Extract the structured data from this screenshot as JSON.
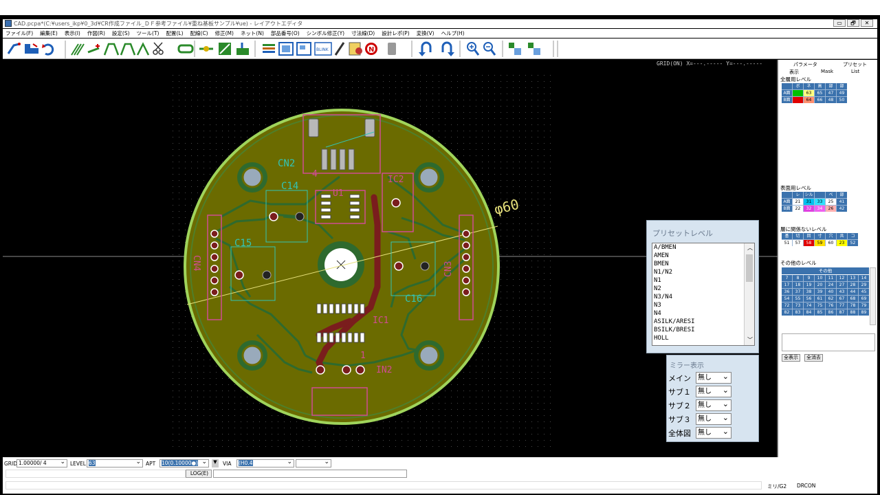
{
  "window": {
    "title": "CAD.pcpa*(C:¥users_ikp¥0_3d¥CR作成ファイル_ＤＦ参考ファイル¥重ね基板サンプル¥ue) - レイアウトエディタ",
    "buttons": [
      "▭",
      "🗗",
      "✕"
    ]
  },
  "menu": [
    "ファイル(F)",
    "編集(E)",
    "表示(I)",
    "作図(R)",
    "設定(S)",
    "ツール(T)",
    "配置(L)",
    "配線(C)",
    "修正(M)",
    "ネット(N)",
    "部品番号(O)",
    "シンボル修正(Y)",
    "寸法線(D)",
    "設計レポ(P)",
    "変換(V)",
    "ヘルプ(H)"
  ],
  "toolbar": {
    "icons": [
      "route-icon",
      "place-icon",
      "rotate-icon",
      "multi-wire-icon",
      "add-point-icon",
      "arc-icon",
      "arc2-icon",
      "line-icon",
      "cut-icon",
      "link-icon",
      "via-icon",
      "flip-icon",
      "move-icon",
      "layer-icon",
      "fit-icon",
      "window-icon",
      "blink-icon",
      "pen-icon",
      "report-icon",
      "no-icon",
      "blank-icon",
      "undo-icon",
      "redo-icon",
      "zoom-in-icon",
      "zoom-out-icon",
      "view1-icon",
      "view2-icon"
    ],
    "blink_label": "BLINK"
  },
  "canvas": {
    "grid_info": "GRID(ON) X=---.----- Y=---.-----",
    "dimension_label": "φ60",
    "ref_labels": [
      "CN2",
      "C14",
      "C15",
      "CN4",
      "CN3",
      "C16",
      "IC1",
      "IC2",
      "IN2",
      "U1",
      "4",
      "1"
    ]
  },
  "right_panel": {
    "tab_top_left": "パラメータ",
    "tab_top_right": "プリセット",
    "tabs": [
      "表示",
      "Mask",
      "List"
    ],
    "all_layer_title": "全層用レベル",
    "all_layer_header": [
      "",
      "ボ",
      "ネ",
      "高",
      "部",
      "部"
    ],
    "all_layer_rows": [
      {
        "label": "A面",
        "values": [
          "",
          "63",
          "65",
          "47",
          "49"
        ]
      },
      {
        "label": "B面",
        "values": [
          "",
          "64",
          "66",
          "48",
          "50"
        ]
      }
    ],
    "surface_title": "表面用レベル",
    "surface_header": [
      "",
      "レ",
      "シル",
      "ベ",
      "部"
    ],
    "surface_rows": [
      {
        "label": "A面",
        "values": [
          "21",
          "31",
          "33",
          "25",
          "41"
        ]
      },
      {
        "label": "B面",
        "values": [
          "22",
          "32",
          "34",
          "26",
          "42"
        ]
      }
    ],
    "nolayer_title": "層に関係ないレベル",
    "nolayer_header": [
      "基",
      "切",
      "回",
      "寸",
      "穴",
      "共",
      "コ"
    ],
    "nolayer_values": [
      "51",
      "57",
      "58",
      "59",
      "60",
      "23",
      "52"
    ],
    "other_title": "その他のレベル",
    "other_header": "その他",
    "other_values": [
      "7",
      "8",
      "9",
      "10",
      "11",
      "12",
      "13",
      "14",
      "17",
      "18",
      "19",
      "20",
      "24",
      "27",
      "28",
      "29",
      "36",
      "37",
      "38",
      "39",
      "40",
      "43",
      "44",
      "45",
      "54",
      "55",
      "56",
      "61",
      "62",
      "67",
      "68",
      "69",
      "72",
      "73",
      "74",
      "75",
      "76",
      "77",
      "78",
      "79",
      "82",
      "83",
      "84",
      "85",
      "86",
      "87",
      "88",
      "89"
    ],
    "show_all": "全表示",
    "clear_all": "全消去"
  },
  "preset": {
    "title": "プリセットレベル",
    "items": [
      "A/BMEN",
      "AMEN",
      "BMEN",
      "N1/N2",
      "N1",
      "N2",
      "N3/N4",
      "N3",
      "N4",
      "ASILK/ARESI",
      "BSILK/BRESI",
      "HOLL"
    ]
  },
  "mirror": {
    "title": "ミラー表示",
    "rows": [
      {
        "label": "メイン",
        "value": "無し"
      },
      {
        "label": "サブ１",
        "value": "無し"
      },
      {
        "label": "サブ２",
        "value": "無し"
      },
      {
        "label": "サブ３",
        "value": "無し"
      },
      {
        "label": "全体図",
        "value": "無し"
      }
    ]
  },
  "status": {
    "grid_label": "GRID",
    "grid_value": "1.00000/ 4",
    "level_label": "LEVEL",
    "level_value": "63",
    "apt_label": "APT",
    "apt_value": "10(0.10000●)",
    "via_label": "VIA",
    "via_value": "(H0.4",
    "log_button": "LOG(E)",
    "unit": "ミリ/G2",
    "drc": "DRCON"
  },
  "colors": {
    "board": "#6b6b00",
    "board_edge": "#9fd45b",
    "trace": "#2e6a2e",
    "red_trace": "#7a1d1d",
    "silk": "#33c4b5",
    "part_outline": "#d04c92",
    "pad_gray": "#9ab"
  }
}
